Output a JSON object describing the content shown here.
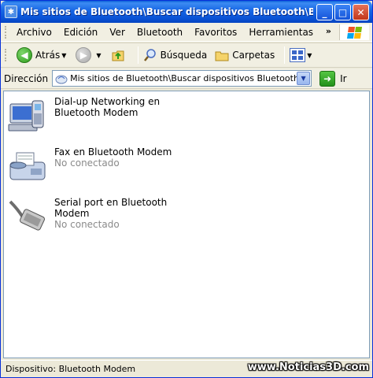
{
  "window": {
    "title": "Mis sitios de Bluetooth\\Buscar dispositivos Bluetooth\\Blu..."
  },
  "menu": {
    "items": [
      "Archivo",
      "Edición",
      "Ver",
      "Bluetooth",
      "Favoritos",
      "Herramientas"
    ],
    "overflow": "»"
  },
  "toolbar": {
    "back_label": "Atrás",
    "search_label": "Búsqueda",
    "folders_label": "Carpetas"
  },
  "address": {
    "label": "Dirección",
    "value": "Mis sitios de Bluetooth\\Buscar dispositivos Bluetooth\\",
    "go_label": "Ir"
  },
  "devices": [
    {
      "name": "Dial-up Networking en Bluetooth Modem",
      "status": "",
      "icon": "dialup-phone-icon"
    },
    {
      "name": "Fax en Bluetooth Modem",
      "status": "No conectado",
      "icon": "fax-icon"
    },
    {
      "name": "Serial port en Bluetooth Modem",
      "status": "No conectado",
      "icon": "serial-cable-icon"
    }
  ],
  "statusbar": {
    "text": "Dispositivo: Bluetooth Modem"
  },
  "watermark": "www.Noticias3D.com",
  "colors": {
    "titlebar": "#0a52d5",
    "menubar": "#f1efe2",
    "content_bg": "#ffffff",
    "status_text": "#8a8a8a"
  }
}
